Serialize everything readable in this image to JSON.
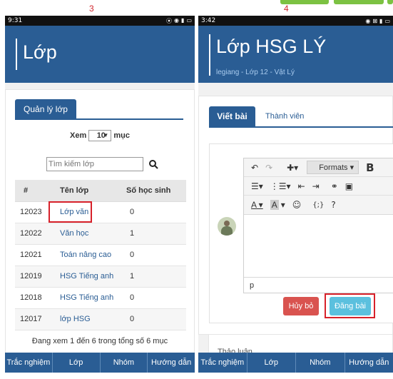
{
  "steps": {
    "left": "3",
    "right": "4"
  },
  "left": {
    "status_time": "9:31",
    "header_title": "Lớp",
    "tab_label": "Quản lý lớp",
    "show_label": "Xem",
    "show_value": "10",
    "show_unit": "mục",
    "search_placeholder": "Tìm kiếm lớp",
    "table": {
      "headers": [
        "#",
        "Tên lớp",
        "Số học sinh"
      ],
      "rows": [
        [
          "12023",
          "Lớp văn",
          "0"
        ],
        [
          "12022",
          "Văn học",
          "1"
        ],
        [
          "12021",
          "Toán nâng cao",
          "0"
        ],
        [
          "12019",
          "HSG Tiếng anh",
          "1"
        ],
        [
          "12018",
          "HSG Tiếng anh",
          "0"
        ],
        [
          "12017",
          "lớp HSG",
          "0"
        ]
      ]
    },
    "footer_info": "Đang xem 1 đến 6 trong tổng số 6 mục",
    "nav": [
      "Trắc nghiệm",
      "Lớp",
      "Nhóm",
      "Hướng dẫn"
    ]
  },
  "right": {
    "status_time": "3:42",
    "header_title": "Lớp HSG LÝ",
    "header_sub": "legiang - Lớp 12 - Vật Lý",
    "tab_post": "Viết bài",
    "tab_members": "Thành viên",
    "formats_label": "Formats",
    "editor_path": "p",
    "cancel_label": "Hủy bỏ",
    "post_label": "Đăng bài",
    "partial_label": "Thảo luận",
    "nav": [
      "Trắc nghiệm",
      "Lớp",
      "Nhóm",
      "Hướng dẫn"
    ]
  },
  "colors": {
    "primary": "#2a5d94",
    "cancel": "#d9534f",
    "post": "#5bc0de",
    "highlight": "#d7212a",
    "top_button": "#7cc242"
  }
}
